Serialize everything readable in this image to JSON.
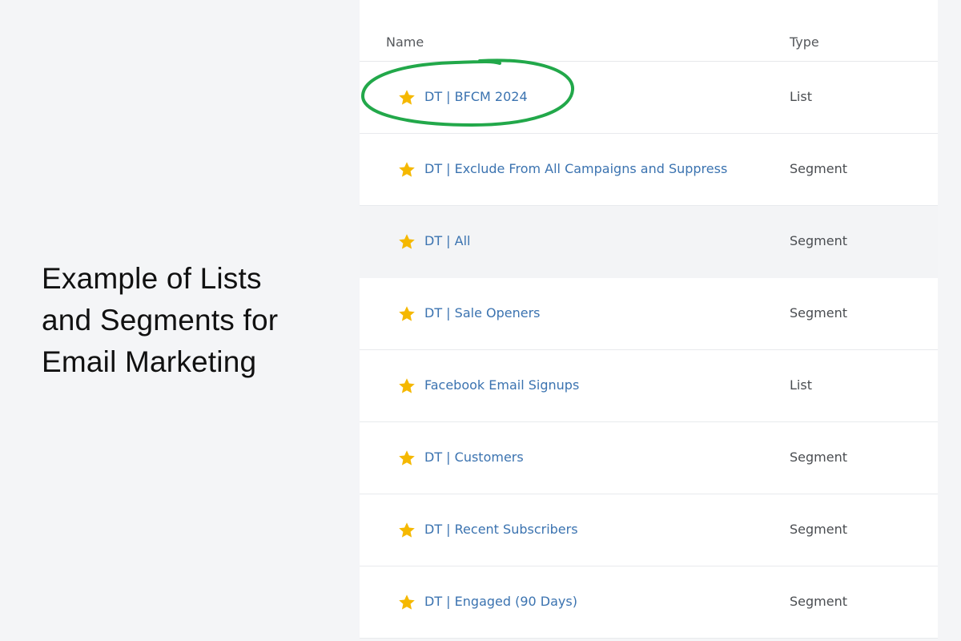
{
  "headline": [
    "Example of Lists",
    "and Segments for",
    "Email Marketing"
  ],
  "table": {
    "headers": {
      "name": "Name",
      "type": "Type"
    },
    "rows": [
      {
        "name": "DT | BFCM 2024",
        "type": "List",
        "starred": true,
        "highlighted": true
      },
      {
        "name": "DT | Exclude From All Campaigns and Suppress",
        "type": "Segment",
        "starred": true
      },
      {
        "name": "DT | All",
        "type": "Segment",
        "starred": true
      },
      {
        "name": "DT | Sale Openers",
        "type": "Segment",
        "starred": true
      },
      {
        "name": "Facebook Email Signups",
        "type": "List",
        "starred": true
      },
      {
        "name": "DT | Customers",
        "type": "Segment",
        "starred": true
      },
      {
        "name": "DT | Recent Subscribers",
        "type": "Segment",
        "starred": true
      },
      {
        "name": "DT | Engaged (90 Days)",
        "type": "Segment",
        "starred": true
      }
    ]
  },
  "colors": {
    "star": "#f5b800",
    "link": "#3b73b0",
    "highlight": "#22a84a",
    "background": "#f4f5f7"
  },
  "icons": {
    "favorite": "star-icon"
  }
}
